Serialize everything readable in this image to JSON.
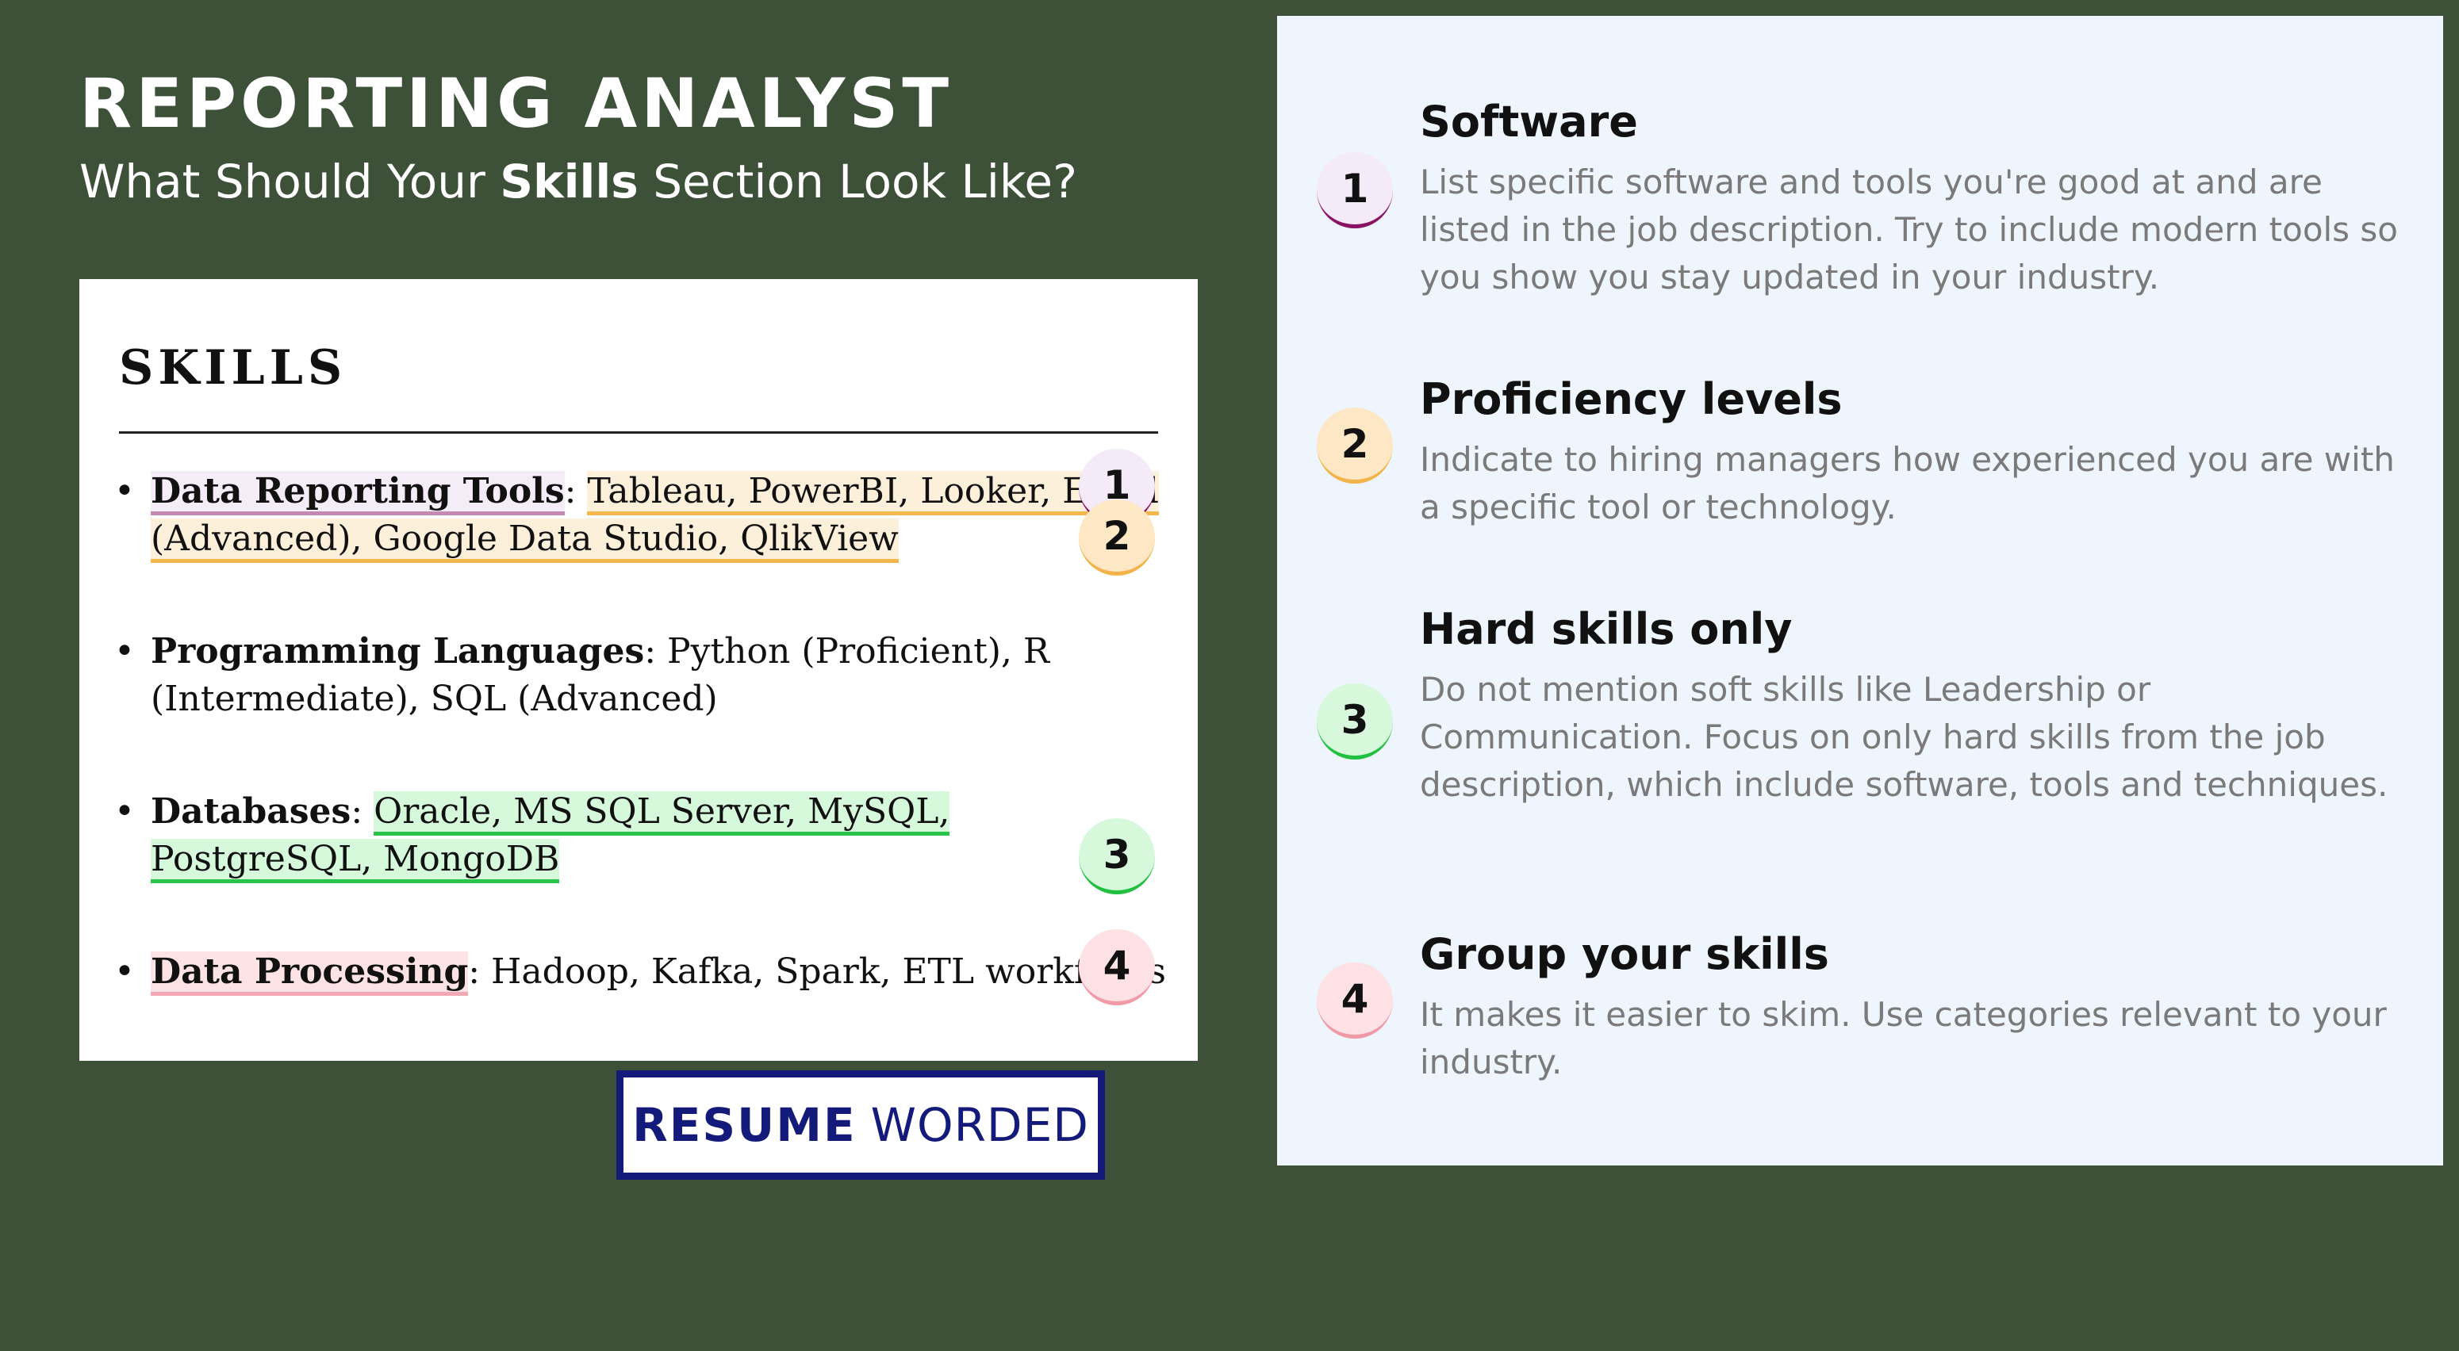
{
  "header": {
    "title": "REPORTING ANALYST",
    "subtitle_before": "What Should Your ",
    "subtitle_bold": "Skills",
    "subtitle_after": " Section Look Like?"
  },
  "resume": {
    "heading": "SKILLS",
    "items": [
      {
        "category": "Data Reporting Tools",
        "separator": ": ",
        "detail": "Tableau, PowerBI, Looker, Excel (Advanced), Google Data Studio, QlikView"
      },
      {
        "category": "Programming Languages",
        "separator": ": ",
        "detail": "Python (Proficient), R (Intermediate), SQL (Advanced)"
      },
      {
        "category": "Databases",
        "separator": ": ",
        "detail": "Oracle, MS SQL Server, MySQL, PostgreSQL, MongoDB"
      },
      {
        "category": "Data Processing",
        "separator": ": ",
        "detail": "Hadoop, Kafka, Spark, ETL workflows"
      }
    ],
    "markers": [
      "1",
      "2",
      "3",
      "4"
    ]
  },
  "logo": {
    "part1": "RESUME",
    "part2": "WORDED"
  },
  "tips": [
    {
      "number": "1",
      "title": "Software",
      "body": "List specific software and tools you're good at and are listed in the job description. Try to include modern tools so you show you stay updated in your industry."
    },
    {
      "number": "2",
      "title": "Proficiency levels",
      "body": "Indicate to hiring managers how experienced you are with a specific tool or technology."
    },
    {
      "number": "3",
      "title": "Hard skills only",
      "body": "Do not mention soft skills like Leadership or Communication. Focus on only hard skills from the job description, which include software, tools and techniques."
    },
    {
      "number": "4",
      "title": "Group your skills",
      "body": "It makes it easier to skim. Use categories relevant to your industry."
    }
  ],
  "colors": {
    "background": "#3d5139",
    "panel": "#eef5fc",
    "marker_1": "#8a1464",
    "marker_2": "#f2b34a",
    "marker_3": "#22c041",
    "marker_4": "#f09aa6",
    "logo": "#141a7a"
  }
}
